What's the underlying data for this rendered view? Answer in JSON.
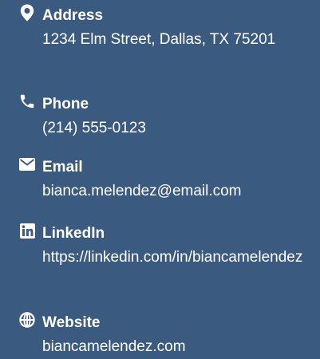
{
  "contact": {
    "items": [
      {
        "icon": "map-marker-icon",
        "label": "Address",
        "value": "1234 Elm Street, Dallas, TX 75201"
      },
      {
        "icon": "phone-icon",
        "label": "Phone",
        "value": "(214) 555-0123"
      },
      {
        "icon": "envelope-icon",
        "label": "Email",
        "value": "bianca.melendez@email.com"
      },
      {
        "icon": "linkedin-icon",
        "label": "LinkedIn",
        "value": "https://linkedin.com/in/biancamelendez"
      },
      {
        "icon": "globe-icon",
        "label": "Website",
        "value": "biancamelendez.com"
      }
    ]
  },
  "colors": {
    "background": "#3a5a80",
    "text": "#ffffff"
  }
}
